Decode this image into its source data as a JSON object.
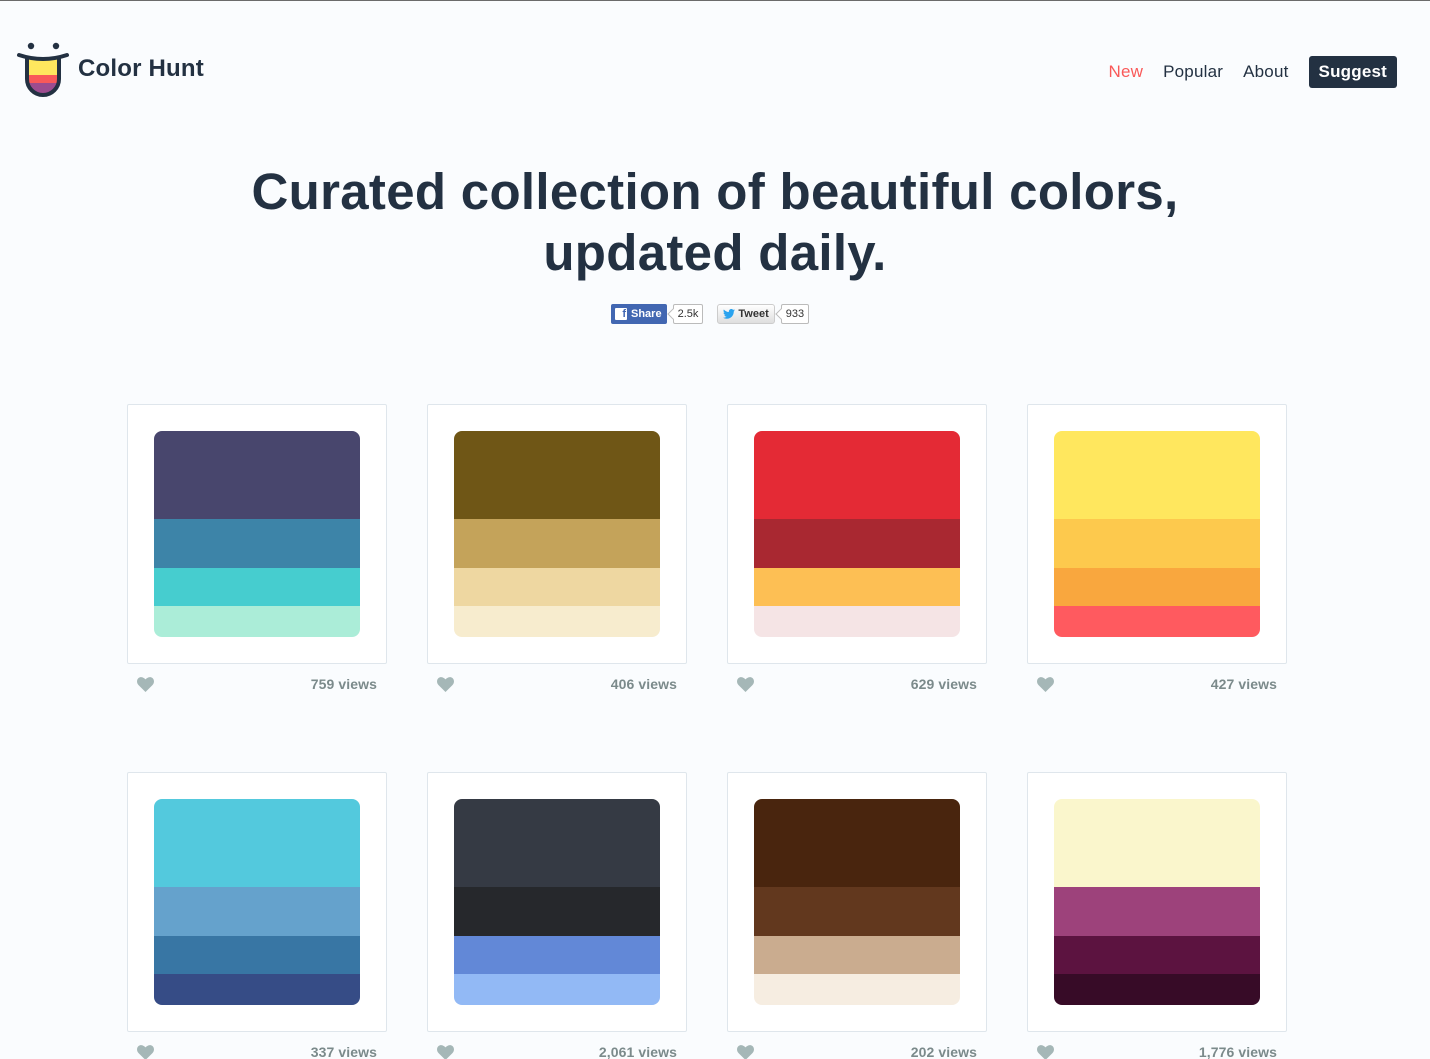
{
  "header": {
    "logo_text": "Color Hunt",
    "logo_icon": "smiling-tongue-icon",
    "nav": [
      {
        "label": "New",
        "active": true
      },
      {
        "label": "Popular",
        "active": false
      },
      {
        "label": "About",
        "active": false
      }
    ],
    "suggest_label": "Suggest"
  },
  "hero": {
    "line1": "Curated collection of beautiful colors,",
    "line2": "updated daily."
  },
  "social": {
    "facebook": {
      "icon": "f",
      "label": "Share",
      "count": "2.5k"
    },
    "twitter": {
      "icon": "twitter-bird-icon",
      "label": "Tweet",
      "count": "933"
    }
  },
  "colors": {
    "accent": "#f95959",
    "dark": "#233142",
    "heart": "#a5b7b7"
  },
  "palettes": [
    {
      "colors": [
        "#48466d",
        "#3d84a8",
        "#46cdcf",
        "#abedd8"
      ],
      "views": "759 views"
    },
    {
      "colors": [
        "#6f5616",
        "#c4a35a",
        "#eed7a1",
        "#f7ecce"
      ],
      "views": "406 views"
    },
    {
      "colors": [
        "#e42a35",
        "#a92831",
        "#fdbf54",
        "#f5e4e5"
      ],
      "views": "629 views"
    },
    {
      "colors": [
        "#ffe75e",
        "#fdc94d",
        "#f9a73e",
        "#ff5a5f"
      ],
      "views": "427 views"
    },
    {
      "colors": [
        "#53c9dd",
        "#65a2cc",
        "#3876a4",
        "#364c86"
      ],
      "views": "337 views"
    },
    {
      "colors": [
        "#353a44",
        "#26282c",
        "#6288d7",
        "#92b9f5"
      ],
      "views": "2,061 views"
    },
    {
      "colors": [
        "#49250e",
        "#62381e",
        "#caac8f",
        "#f6ede1"
      ],
      "views": "202 views"
    },
    {
      "colors": [
        "#faf6cc",
        "#9d427b",
        "#5c1340",
        "#370b27"
      ],
      "views": "1,776 views"
    }
  ]
}
